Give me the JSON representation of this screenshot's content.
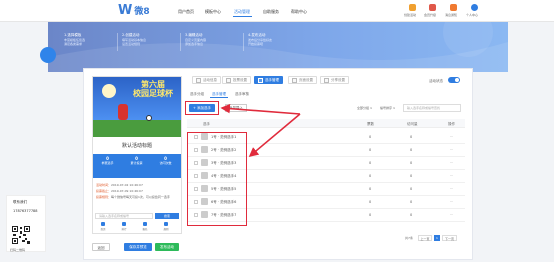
{
  "header": {
    "logo_icon": "W",
    "logo_text": "微8",
    "nav": [
      "用户首页",
      "模板中心",
      "活动管理",
      "自助服务",
      "帮助中心"
    ],
    "active_nav": "活动管理",
    "tools": [
      {
        "label": "创建活动",
        "icon": "create-icon",
        "color": "#f0a030"
      },
      {
        "label": "会员升级",
        "icon": "vip-icon",
        "color": "#e0584a"
      },
      {
        "label": "消息通知",
        "icon": "bell-icon",
        "color": "#f07a30"
      },
      {
        "label": "个人中心",
        "icon": "user-icon",
        "color": "#2f7de1"
      }
    ]
  },
  "banner": {
    "steps": [
      {
        "num": "1.选择模板",
        "lines": [
          "丰富模板任您选",
          "满足各类需求"
        ]
      },
      {
        "num": "2.创建活动",
        "lines": [
          "填写活动基本信息",
          "设置活动规则"
        ]
      },
      {
        "num": "3.编辑活动",
        "lines": [
          "自定义页面内容",
          "添加选手信息"
        ]
      },
      {
        "num": "4.发布活动",
        "lines": [
          "发布后分享给好友",
          "开始投票吧"
        ]
      }
    ]
  },
  "preview": {
    "poster_title": [
      "第六届",
      "校园足球杯"
    ],
    "vote_title": "默认活动标题",
    "stats": [
      {
        "num": "0",
        "label": "参赛选手"
      },
      {
        "num": "0",
        "label": "累计投票"
      },
      {
        "num": "0",
        "label": "访问次数"
      }
    ],
    "info": [
      {
        "key": "活动时间：",
        "value": "2019-07-02 10:46:07"
      },
      {
        "key": "投票截止：",
        "value": "2019-07-09 10:46:07"
      },
      {
        "key": "投票规则：",
        "value": "每个微信号每天可投1次，可以投给同一选手"
      }
    ],
    "search_placeholder": "请输入选手名称或编号",
    "search_button": "搜索",
    "tabs": [
      "首页",
      "排行",
      "报名",
      "规则"
    ]
  },
  "actions": {
    "back": "返回",
    "save": "保存并预览",
    "publish": "发布活动"
  },
  "steps": {
    "chips": [
      "活动信息",
      "投票设置",
      "选手管理",
      "页面设置",
      "分享设置"
    ],
    "active_chip": "选手管理",
    "toggle_label": "活动状态",
    "toggle_on": true
  },
  "subtabs": {
    "items": [
      "选手分组",
      "选手管理",
      "选手审核"
    ],
    "active": "选手管理"
  },
  "toolbar": {
    "add_player": "+ 添加选手",
    "import": "批量导入",
    "filter_group": "全部分组 ∨",
    "filter_sort": "编号排序 ∨",
    "search_placeholder": "输入选手名称或编号查找"
  },
  "table": {
    "headers": [
      "选手",
      "票数",
      "访问量",
      "操作"
    ],
    "rows": [
      {
        "name": "1号 · 范例选手1",
        "votes": "0",
        "views": "0",
        "op": "···"
      },
      {
        "name": "2号 · 范例选手2",
        "votes": "0",
        "views": "0",
        "op": "···"
      },
      {
        "name": "3号 · 范例选手3",
        "votes": "0",
        "views": "0",
        "op": "···"
      },
      {
        "name": "4号 · 范例选手4",
        "votes": "0",
        "views": "0",
        "op": "···"
      },
      {
        "name": "5号 · 范例选手5",
        "votes": "0",
        "views": "0",
        "op": "···"
      },
      {
        "name": "6号 · 范例选手6",
        "votes": "0",
        "views": "0",
        "op": "···"
      },
      {
        "name": "7号 · 范例选手7",
        "votes": "0",
        "views": "0",
        "op": "···"
      }
    ]
  },
  "pagination": {
    "total": "共7条",
    "prev": "上一页",
    "current": "1",
    "next": "下一页"
  },
  "contact": {
    "title": "联系我们",
    "phone": "17876377788",
    "qr_label": "扫码二维码"
  },
  "colors": {
    "primary": "#2f7de1",
    "highlight": "#e02b3c"
  }
}
